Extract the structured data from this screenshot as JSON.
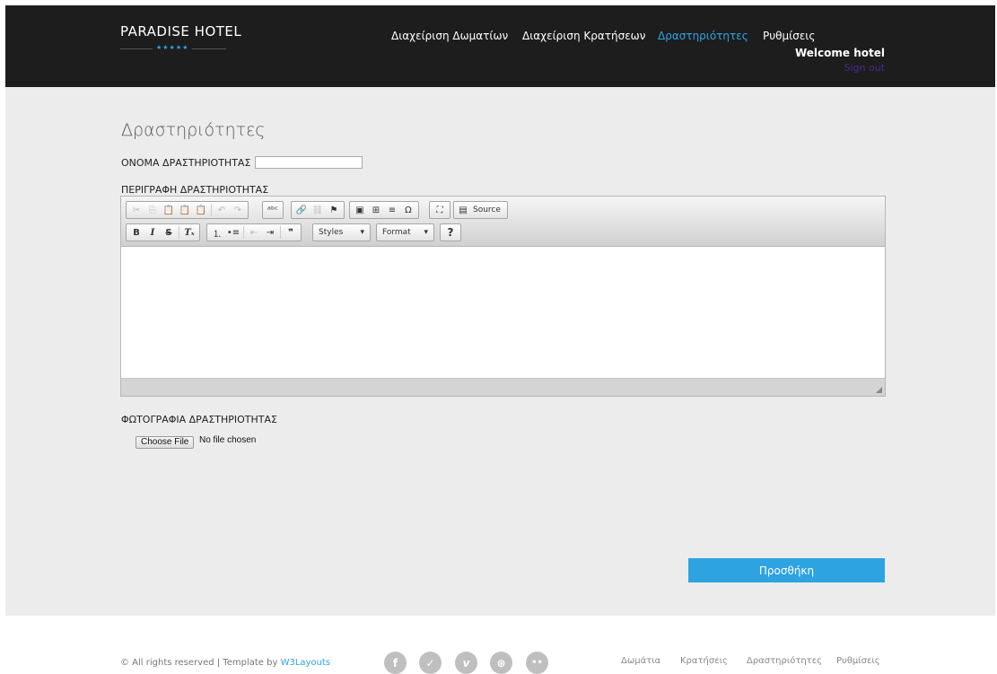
{
  "brand": {
    "name": "PARADISE HOTEL",
    "stars": "★★★★★"
  },
  "nav": [
    {
      "label": "Διαχείριση Δωματίων"
    },
    {
      "label": "Διαχείριση Κρατήσεων"
    },
    {
      "label": "Δραστηριότητες",
      "active": true
    },
    {
      "label": "Ρυθμίσεις"
    }
  ],
  "user": {
    "welcome": "Welcome hotel",
    "signout": "Sign out"
  },
  "page": {
    "title": "Δραστηριότητες",
    "name_label": "ΟΝΟΜΑ ΔΡΑΣΤΗΡΙΟΤΗΤΑΣ",
    "name_value": "",
    "desc_label": "ΠΕΡΙΓΡΑΦΗ ΔΡΑΣΤΗΡΙΟΤΗΤΑΣ",
    "photo_label": "ΦΩΤΟΓΡΑΦΙΑ ΔΡΑΣΤΗΡΙΟΤΗΤΑΣ",
    "file_button": "Choose File",
    "file_status": "No file chosen",
    "submit": "Προσθήκη"
  },
  "editor": {
    "source_label": "Source",
    "styles_label": "Styles",
    "format_label": "Format",
    "help_label": "?"
  },
  "footer": {
    "copyright": "© All rights reserved | Template by",
    "template_link": "W3Layouts",
    "social": [
      "facebook",
      "twitter",
      "vimeo",
      "dribbble",
      "flickr"
    ],
    "links": [
      "Δωμάτια",
      "Κρατήσεις",
      "Δραστηριότητες",
      "Ρυθμίσεις"
    ]
  },
  "colors": {
    "accent": "#2ea3e2",
    "header_bg": "#1d1d1d",
    "main_bg": "#ececec",
    "signout": "#4b2a8a"
  }
}
